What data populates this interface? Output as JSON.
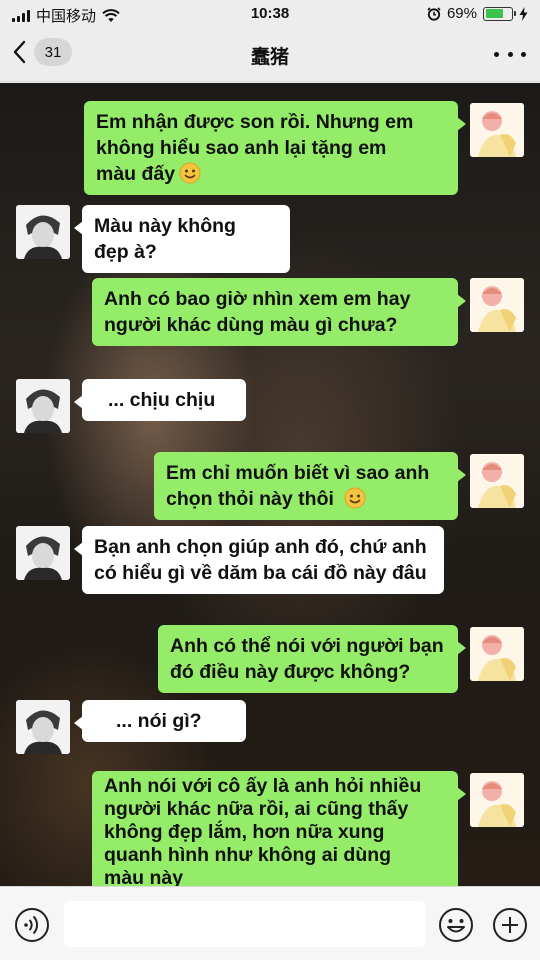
{
  "status_bar": {
    "carrier": "中国移动",
    "time": "10:38",
    "battery_percent": "69%",
    "battery_level": 0.69,
    "icons": [
      "signal-icon",
      "wifi-icon",
      "alarm-icon",
      "battery-icon",
      "charging-icon"
    ]
  },
  "nav": {
    "back_icon": "chevron-left-icon",
    "unread_count": "31",
    "title": "蠢猪",
    "more_icon": "more-dots-icon"
  },
  "messages": [
    {
      "sender": "me",
      "lines": [
        "Em nhận được son rồi. Nhưng em",
        "không hiểu sao anh lại tặng em",
        "màu đấy"
      ],
      "emoji": "smiley-emoji-icon"
    },
    {
      "sender": "them",
      "lines": [
        "Màu này không",
        "đẹp à?"
      ]
    },
    {
      "sender": "me",
      "lines": [
        "Anh có bao giờ nhìn xem em hay",
        "người khác dùng màu gì chưa?"
      ]
    },
    {
      "sender": "them",
      "lines": [
        "... chịu chịu"
      ]
    },
    {
      "sender": "me",
      "lines": [
        "Em chỉ muốn biết vì sao anh",
        "chọn thỏi này thôi"
      ],
      "emoji": "smiley-emoji-icon"
    },
    {
      "sender": "them",
      "lines": [
        "Bạn anh chọn giúp anh đó, chứ anh",
        "có hiểu gì về dăm ba cái đồ này đâu"
      ]
    },
    {
      "sender": "me",
      "lines": [
        "Anh có thể nói với người bạn",
        "đó điều này được không?"
      ]
    },
    {
      "sender": "them",
      "lines": [
        "... nói gì?"
      ]
    },
    {
      "sender": "me",
      "lines": [
        "Anh nói với cô ấy là anh hỏi nhiều",
        "người khác nữa rồi, ai cũng thấy",
        "không đẹp lắm, hơn nữa xung",
        "quanh hình như không ai dùng",
        "màu này"
      ]
    }
  ],
  "input_bar": {
    "voice_icon": "voice-icon",
    "input_value": "",
    "emoji_icon": "emoji-icon",
    "plus_icon": "plus-icon"
  },
  "colors": {
    "my_bubble": "#95ec69",
    "their_bubble": "#ffffff",
    "bar_background": "#ededed"
  }
}
